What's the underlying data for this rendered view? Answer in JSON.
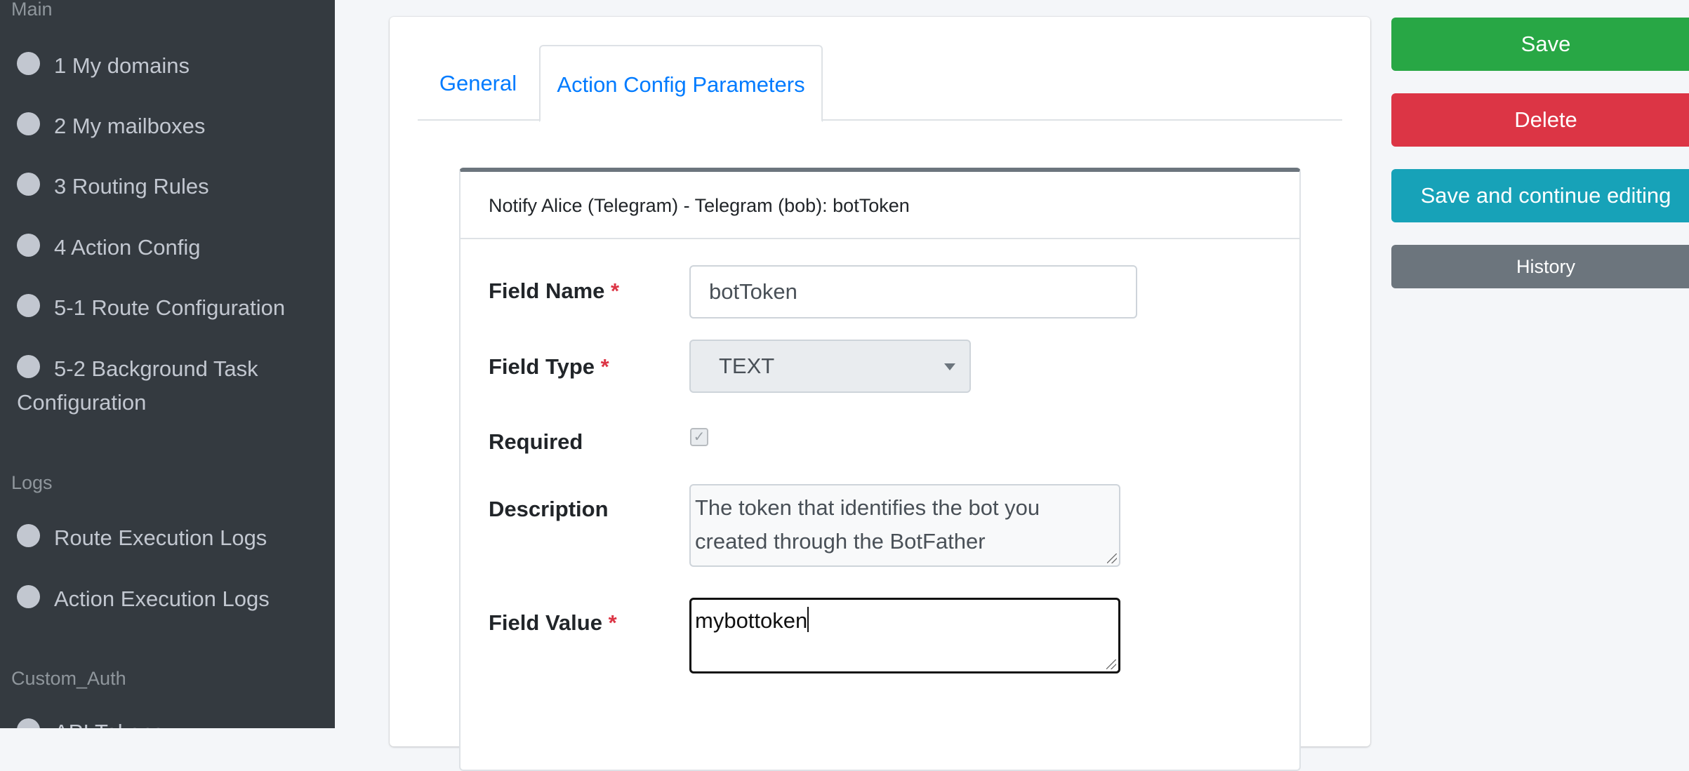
{
  "sidebar": {
    "header_main": "Main",
    "items_main": [
      {
        "label": "1 My domains"
      },
      {
        "label": "2 My mailboxes"
      },
      {
        "label": "3 Routing Rules"
      },
      {
        "label": "4 Action Config"
      },
      {
        "label": "5-1 Route Configuration"
      },
      {
        "label_line1": "5-2 Background Task",
        "label_line2": "Configuration"
      }
    ],
    "header_logs": "Logs",
    "items_logs": [
      {
        "label": "Route Execution Logs"
      },
      {
        "label": "Action Execution Logs"
      }
    ],
    "header_auth": "Custom_Auth",
    "item_auth_partial": "API Tokens"
  },
  "tabs": [
    {
      "label": "General"
    },
    {
      "label": "Action Config Parameters"
    }
  ],
  "inline": {
    "heading": "Notify Alice (Telegram) - Telegram (bob): botToken",
    "field_name_label": "Field Name",
    "field_name_value": "botToken",
    "field_type_label": "Field Type",
    "field_type_value": "TEXT",
    "required_label": "Required",
    "required_checked": true,
    "description_label": "Description",
    "description_value": "The token that identifies the bot you created through the BotFather",
    "field_value_label": "Field Value",
    "field_value_value": "mybottoken",
    "required_marker": "*"
  },
  "actions": {
    "save": "Save",
    "delete": "Delete",
    "save_continue": "Save and continue editing",
    "history": "History"
  },
  "colors": {
    "sidebar_bg": "#343a40",
    "save": "#28a745",
    "delete": "#dc3545",
    "save_continue": "#17a2b8",
    "history": "#6c757d",
    "link": "#007bff"
  }
}
